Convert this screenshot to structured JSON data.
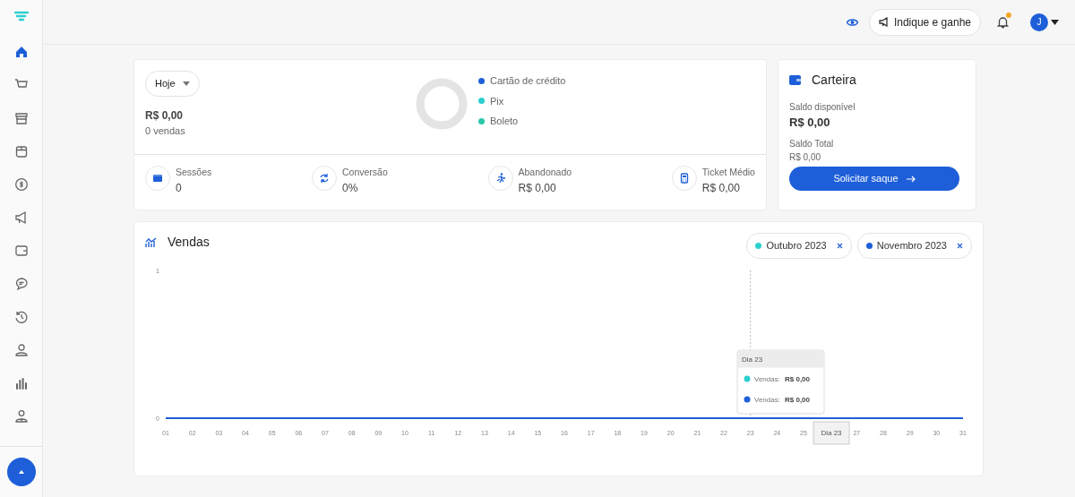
{
  "sidebar": {
    "items": [
      {
        "kind": "home",
        "selected": true
      },
      {
        "kind": "cart",
        "selected": false
      },
      {
        "kind": "store",
        "selected": false
      },
      {
        "kind": "box",
        "selected": false
      },
      {
        "kind": "coin",
        "selected": false
      },
      {
        "kind": "megaphone",
        "selected": false
      },
      {
        "kind": "wallet",
        "selected": false
      },
      {
        "kind": "chat",
        "selected": false
      },
      {
        "kind": "history",
        "selected": false
      },
      {
        "kind": "user",
        "selected": false
      },
      {
        "kind": "bars",
        "selected": false
      },
      {
        "kind": "users",
        "selected": false
      }
    ]
  },
  "topbar": {
    "refer_button": "Indique e ganhe",
    "notification_dot": true,
    "avatar": "J"
  },
  "summary": {
    "period": "Hoje",
    "total": "R$ 0,00",
    "sales": "0 vendas",
    "legend": [
      {
        "label": "Cartão de crédito",
        "color": "#1e5fd9"
      },
      {
        "label": "Pix",
        "color": "#2ccfd0"
      },
      {
        "label": "Boleto",
        "color": "#2ac7a8"
      }
    ],
    "stats": [
      {
        "kind": "sessions",
        "label": "Sessões",
        "value": "0"
      },
      {
        "kind": "conversion",
        "label": "Conversão",
        "value": "0%"
      },
      {
        "kind": "abandoned",
        "label": "Abandonado",
        "value": "R$ 0,00"
      },
      {
        "kind": "ticket",
        "label": "Ticket Médio",
        "value": "R$ 0,00"
      }
    ]
  },
  "wallet": {
    "title": "Carteira",
    "available_label": "Saldo disponível",
    "available": "R$ 0,00",
    "total_label": "Saldo Total",
    "total": "R$ 0,00",
    "button": "Solicitar saque"
  },
  "sales": {
    "title": "Vendas",
    "chart_data": {
      "type": "line",
      "categories": [
        "01",
        "02",
        "03",
        "04",
        "05",
        "06",
        "07",
        "08",
        "09",
        "10",
        "11",
        "12",
        "13",
        "14",
        "15",
        "16",
        "17",
        "18",
        "19",
        "20",
        "21",
        "22",
        "23",
        "24",
        "25",
        null,
        "27",
        "28",
        "29",
        "30",
        "31"
      ],
      "series": [
        {
          "name": "Outubro 2023",
          "color": "#2ccfd0",
          "values": [
            null,
            null,
            null,
            null,
            null,
            null,
            null,
            null,
            null,
            null,
            null,
            null,
            null,
            null,
            null,
            null,
            null,
            null,
            null,
            null,
            null,
            null,
            null,
            null,
            null,
            null,
            null,
            null,
            null,
            null,
            null
          ]
        },
        {
          "name": "Novembro 2023",
          "color": "#1e5fd9",
          "values": [
            0,
            0,
            0,
            0,
            0,
            0,
            0,
            0,
            0,
            0,
            0,
            0,
            0,
            0,
            0,
            0,
            0,
            0,
            0,
            0,
            0,
            0,
            0,
            0,
            0,
            0,
            0,
            0,
            0,
            0,
            0
          ]
        }
      ],
      "ylim": [
        0,
        1
      ],
      "yticks": [
        0,
        1
      ]
    },
    "tooltip": {
      "title": "Dia 23",
      "rows": [
        {
          "label": "Vendas:",
          "value": "R$ 0,00",
          "color": "#2ccfd0"
        },
        {
          "label": "Vendas:",
          "value": "R$ 0,00",
          "color": "#1e5fd9"
        }
      ]
    },
    "crosshair_label": "Dia 23"
  }
}
